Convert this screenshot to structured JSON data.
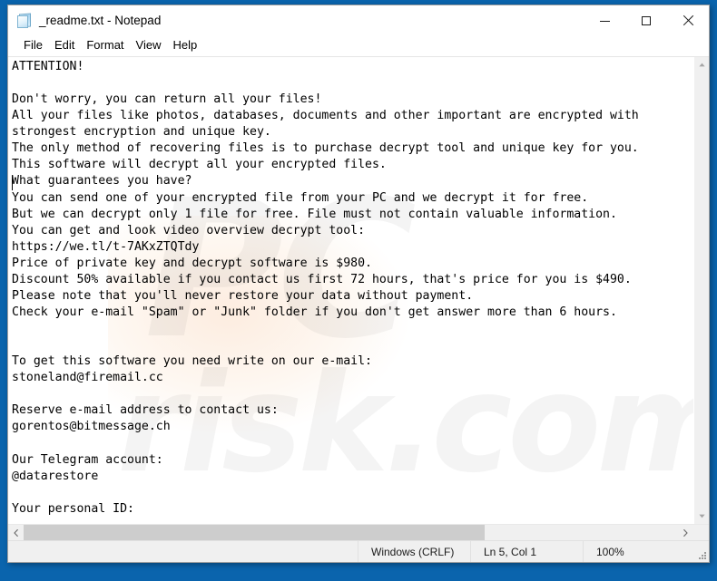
{
  "window": {
    "title": "_readme.txt - Notepad",
    "icon": "notepad-icon",
    "controls": {
      "minimize": "–",
      "maximize": "☐",
      "close": "✕"
    }
  },
  "menubar": {
    "items": [
      {
        "label": "File"
      },
      {
        "label": "Edit"
      },
      {
        "label": "Format"
      },
      {
        "label": "View"
      },
      {
        "label": "Help"
      }
    ]
  },
  "editor": {
    "content": "ATTENTION!\n\nDon't worry, you can return all your files!\nAll your files like photos, databases, documents and other important are encrypted with\nstrongest encryption and unique key.\nThe only method of recovering files is to purchase decrypt tool and unique key for you.\nThis software will decrypt all your encrypted files.\nWhat guarantees you have?\nYou can send one of your encrypted file from your PC and we decrypt it for free.\nBut we can decrypt only 1 file for free. File must not contain valuable information.\nYou can get and look video overview decrypt tool:\nhttps://we.tl/t-7AKxZTQTdy\nPrice of private key and decrypt software is $980.\nDiscount 50% available if you contact us first 72 hours, that's price for you is $490.\nPlease note that you'll never restore your data without payment.\nCheck your e-mail \"Spam\" or \"Junk\" folder if you don't get answer more than 6 hours.\n\n\nTo get this software you need write on our e-mail:\nstoneland@firemail.cc\n\nReserve e-mail address to contact us:\ngorentos@bitmessage.ch\n\nOur Telegram account:\n@datarestore\n\nYour personal ID:\n-",
    "lines": [
      "ATTENTION!",
      "",
      "Don't worry, you can return all your files!",
      "All your files like photos, databases, documents and other important are encrypted with",
      "strongest encryption and unique key.",
      "The only method of recovering files is to purchase decrypt tool and unique key for you.",
      "This software will decrypt all your encrypted files.",
      "What guarantees you have?",
      "You can send one of your encrypted file from your PC and we decrypt it for free.",
      "But we can decrypt only 1 file for free. File must not contain valuable information.",
      "You can get and look video overview decrypt tool:",
      "https://we.tl/t-7AKxZTQTdy",
      "Price of private key and decrypt software is $980.",
      "Discount 50% available if you contact us first 72 hours, that's price for you is $490.",
      "Please note that you'll never restore your data without payment.",
      "Check your e-mail \"Spam\" or \"Junk\" folder if you don't get answer more than 6 hours.",
      "",
      "",
      "To get this software you need write on our e-mail:",
      "stoneland@firemail.cc",
      "",
      "Reserve e-mail address to contact us:",
      "gorentos@bitmessage.ch",
      "",
      "Our Telegram account:",
      "@datarestore",
      "",
      "Your personal ID:",
      "-"
    ],
    "details": {
      "video_url": "https://we.tl/t-7AKxZTQTdy",
      "price_full": "$980",
      "price_discount": "$490",
      "discount_percent": "50%",
      "discount_window": "72 hours",
      "answer_window": "6 hours",
      "primary_email": "stoneland@firemail.cc",
      "reserve_email": "gorentos@bitmessage.ch",
      "telegram": "@datarestore",
      "personal_id": "-"
    }
  },
  "watermark": {
    "line1": "PC",
    "line2": "risk.com"
  },
  "scrollbars": {
    "vertical": {
      "up_arrow": "▲",
      "down_arrow": "▼"
    },
    "horizontal": {
      "left_arrow": "❮",
      "right_arrow": "❯"
    }
  },
  "statusbar": {
    "encoding": "Windows (CRLF)",
    "position": "Ln 5, Col 1",
    "zoom": "100%"
  },
  "colors": {
    "desktop": "#0a64ad",
    "window_bg": "#ffffff",
    "statusbar_bg": "#f0f0f0",
    "scroll_thumb": "#cdcdcd",
    "text": "#000000"
  }
}
